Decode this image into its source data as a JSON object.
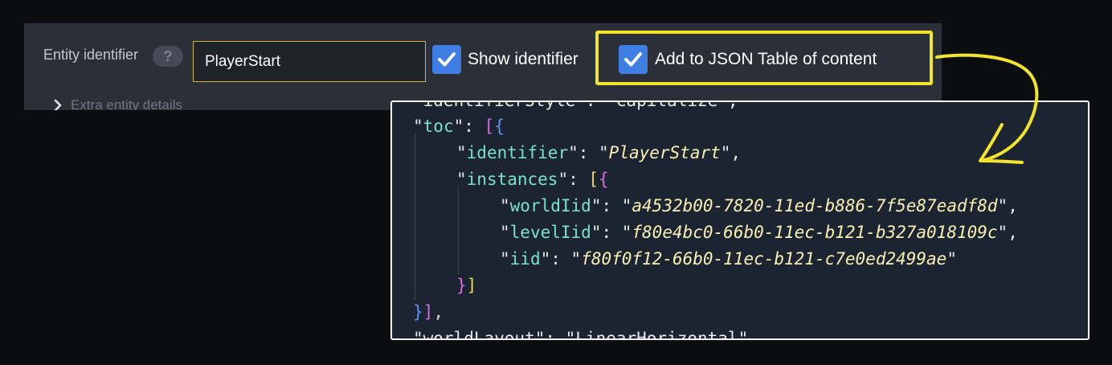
{
  "panel": {
    "field_label": "Entity identifier",
    "help_badge": "?",
    "identifier_value": "PlayerStart",
    "show_identifier_label": "Show identifier",
    "add_toc_label": "Add to JSON Table of content",
    "extra_details_label": "Extra entity details"
  },
  "code": {
    "top_fragment": "\"identifierStyle\": \"Capitalize\",",
    "toc_key": "toc",
    "identifier_key": "identifier",
    "identifier_value": "PlayerStart",
    "instances_key": "instances",
    "world_iid_key": "worldIid",
    "world_iid_value": "a4532b00-7820-11ed-b886-7f5e87eadf8d",
    "level_iid_key": "levelIid",
    "level_iid_value": "f80e4bc0-66b0-11ec-b121-b327a018109c",
    "iid_key": "iid",
    "iid_value": "f80f0f12-66b0-11ec-b121-c7e0ed2499ae",
    "bottom_fragment": "\"worldLayout\": \"LinearHorizontal\","
  },
  "colors": {
    "accent_blue": "#3f7fe3",
    "highlight_yellow": "#f2e42c",
    "input_border": "#d8b332"
  },
  "icons": [
    "checkmark-icon",
    "chevron-right-icon",
    "hand-drawn-arrow"
  ]
}
